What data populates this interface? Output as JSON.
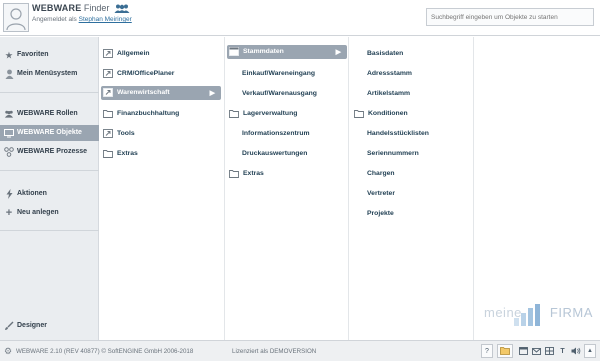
{
  "header": {
    "brand_bold": "WEBWARE",
    "brand_light": "Finder",
    "login_prefix": "Angemeldet als",
    "user": "Stephan Meiringer",
    "search_placeholder": "Suchbegriff eingeben um Objekte zu starten"
  },
  "sidebar": {
    "favoriten": "Favoriten",
    "menusystem": "Mein Menüsystem",
    "rollen": "WEBWARE Rollen",
    "objekte": "WEBWARE Objekte",
    "prozesse": "WEBWARE Prozesse",
    "aktionen": "Aktionen",
    "neu": "Neu anlegen",
    "designer": "Designer"
  },
  "col1": [
    "Allgemein",
    "CRM/OfficePlaner",
    "Warenwirtschaft",
    "Finanzbuchhaltung",
    "Tools",
    "Extras"
  ],
  "col2": [
    "Stammdaten",
    "Einkauf/Wareneingang",
    "Verkauf/Warenausgang",
    "Lagerverwaltung",
    "Informationszentrum",
    "Druckauswertungen",
    "Extras"
  ],
  "col3": [
    "Basisdaten",
    "Adressstamm",
    "Artikelstamm",
    "Konditionen",
    "Handelsstücklisten",
    "Seriennummern",
    "Chargen",
    "Vertreter",
    "Projekte"
  ],
  "watermark": {
    "light": "meine",
    "bold": "FIRMA"
  },
  "footer": {
    "version": "WEBWARE 2.10 (REV 40877) © SoftENGINE GmbH 2006-2018",
    "license": "Lizenziert als DEMOVERSION",
    "help": "?"
  },
  "colors": {
    "selection": "#9aa5b1",
    "link": "#2e6f9e",
    "text": "#1f3e52"
  }
}
